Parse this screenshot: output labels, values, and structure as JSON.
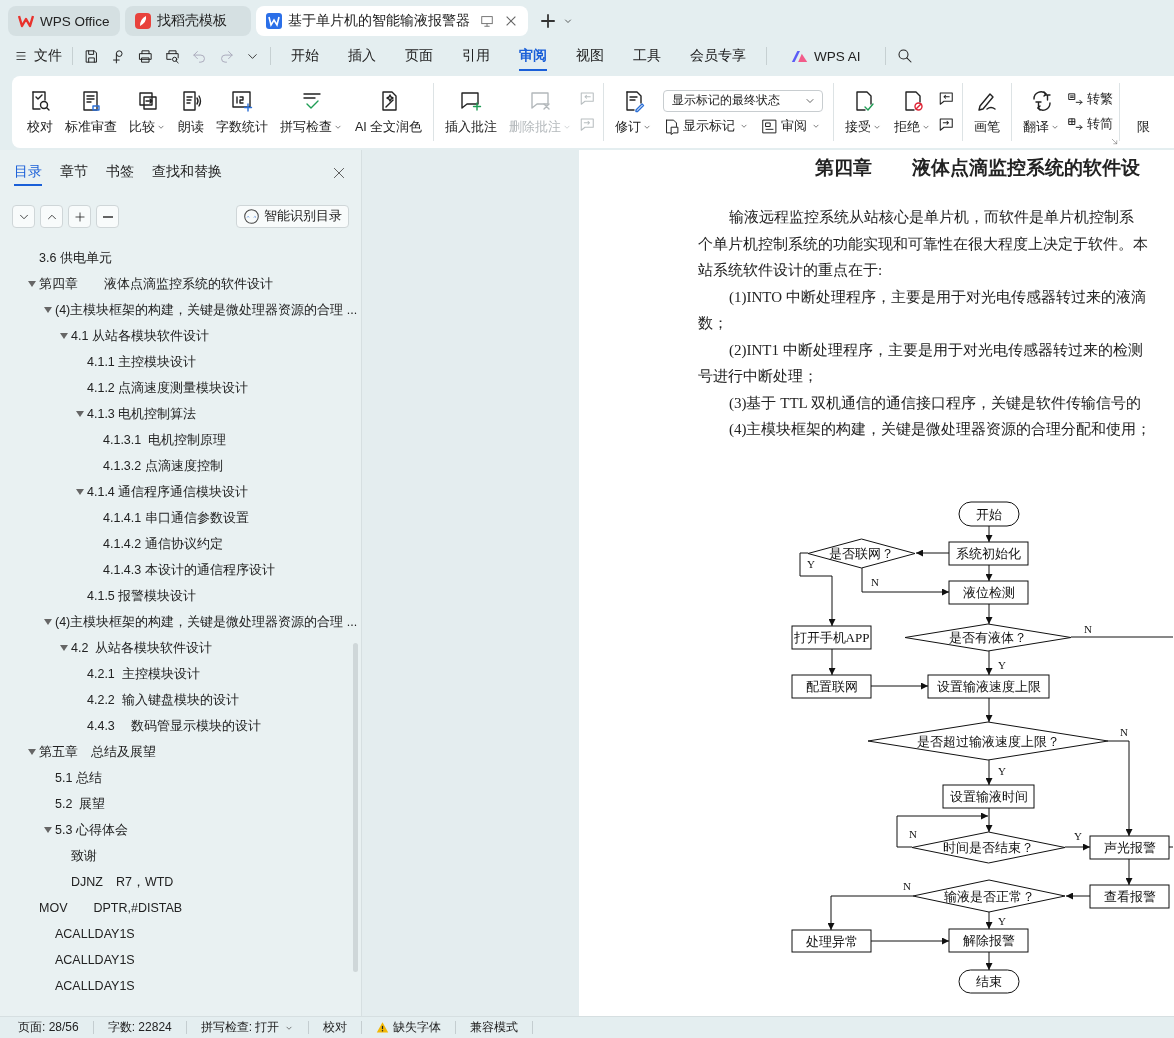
{
  "tabs": [
    {
      "label": "WPS Office",
      "kind": "home",
      "selected": false
    },
    {
      "label": "找稻壳模板",
      "kind": "template",
      "selected": false
    },
    {
      "label": "基于单片机的智能输液报警器",
      "kind": "document",
      "selected": true
    }
  ],
  "menu": {
    "file": "文件",
    "tabs": [
      {
        "label": "开始",
        "selected": false
      },
      {
        "label": "插入",
        "selected": false
      },
      {
        "label": "页面",
        "selected": false
      },
      {
        "label": "引用",
        "selected": false
      },
      {
        "label": "审阅",
        "selected": true
      },
      {
        "label": "视图",
        "selected": false
      },
      {
        "label": "工具",
        "selected": false
      },
      {
        "label": "会员专享",
        "selected": false
      }
    ],
    "ai": "WPS AI"
  },
  "ribbon": [
    {
      "items": [
        {
          "kind": "large",
          "label": "校对",
          "dropdown": false,
          "disabled": false
        },
        {
          "kind": "large",
          "label": "标准审查",
          "dropdown": false,
          "disabled": false
        },
        {
          "kind": "large",
          "label": "比较",
          "dropdown": true,
          "disabled": false
        },
        {
          "kind": "large",
          "label": "朗读",
          "dropdown": false,
          "disabled": false
        },
        {
          "kind": "large",
          "label": "字数统计",
          "dropdown": false,
          "disabled": false
        },
        {
          "kind": "large",
          "label": "拼写检查",
          "dropdown": true,
          "disabled": false
        },
        {
          "kind": "large",
          "label": "AI 全文润色",
          "dropdown": false,
          "disabled": false
        }
      ]
    },
    {
      "items": [
        {
          "kind": "large",
          "label": "插入批注",
          "dropdown": false,
          "disabled": false
        },
        {
          "kind": "large",
          "label": "删除批注",
          "dropdown": true,
          "disabled": true
        },
        {
          "kind": "stack",
          "buttons": [
            {
              "disabled": true
            },
            {
              "disabled": true
            }
          ]
        }
      ]
    },
    {
      "items": [
        {
          "kind": "large",
          "label": "修订",
          "dropdown": true,
          "disabled": false
        },
        {
          "kind": "select_block",
          "value": "显示标记的最终状态",
          "buttons": [
            {
              "label": "显示标记",
              "dropdown": true
            },
            {
              "label": "审阅",
              "dropdown": true
            }
          ]
        }
      ]
    },
    {
      "items": [
        {
          "kind": "large",
          "label": "接受",
          "dropdown": true,
          "disabled": false
        },
        {
          "kind": "large",
          "label": "拒绝",
          "dropdown": true,
          "disabled": false
        },
        {
          "kind": "stack",
          "buttons": [
            {
              "disabled": false
            },
            {
              "disabled": false
            }
          ]
        }
      ]
    },
    {
      "items": [
        {
          "kind": "large",
          "label": "画笔",
          "dropdown": false,
          "disabled": false
        }
      ]
    },
    {
      "launcher": true,
      "items": [
        {
          "kind": "large",
          "label": "翻译",
          "dropdown": true,
          "disabled": false
        },
        {
          "kind": "small_stack",
          "buttons": [
            {
              "label": "转繁"
            },
            {
              "label": "转简"
            }
          ]
        }
      ]
    },
    {
      "items": [
        {
          "kind": "large",
          "label": "限",
          "dropdown": false,
          "disabled": false
        }
      ]
    }
  ],
  "panel": {
    "tabs": [
      {
        "label": "目录",
        "selected": true
      },
      {
        "label": "章节",
        "selected": false
      },
      {
        "label": "书签",
        "selected": false
      },
      {
        "label": "查找和替换",
        "selected": false
      }
    ],
    "smart_button": "智能识别目录",
    "toc": [
      {
        "label": "3.6 供电单元"
      },
      {
        "label": "第四章　　液体点滴监控系统的软件设计",
        "expanded": true,
        "children": [
          {
            "label": "(4)主模块框架的构建，关键是微处理器资源的合理 ...",
            "expanded": true,
            "children": [
              {
                "label": "4.1 从站各模块软件设计",
                "expanded": true,
                "children": [
                  {
                    "label": "4.1.1 主控模块设计"
                  },
                  {
                    "label": "4.1.2 点滴速度测量模块设计"
                  },
                  {
                    "label": "4.1.3 电机控制算法",
                    "expanded": true,
                    "children": [
                      {
                        "label": "4.1.3.1  电机控制原理"
                      },
                      {
                        "label": "4.1.3.2 点滴速度控制"
                      }
                    ]
                  },
                  {
                    "label": "4.1.4 通信程序通信模块设计",
                    "expanded": true,
                    "children": [
                      {
                        "label": "4.1.4.1 串口通信参数设置"
                      },
                      {
                        "label": "4.1.4.2 通信协议约定"
                      },
                      {
                        "label": "4.1.4.3 本设计的通信程序设计"
                      }
                    ]
                  },
                  {
                    "label": "4.1.5 报警模块设计"
                  }
                ]
              }
            ]
          },
          {
            "label": "(4)主模块框架的构建，关键是微处理器资源的合理 ...",
            "expanded": true,
            "children": [
              {
                "label": "4.2  从站各模块软件设计",
                "expanded": true,
                "children": [
                  {
                    "label": "4.2.1  主控模块设计"
                  },
                  {
                    "label": "4.2.2  输入键盘模块的设计"
                  },
                  {
                    "label": "4.4.3　 数码管显示模块的设计"
                  }
                ]
              }
            ]
          }
        ]
      },
      {
        "label": "第五章　总结及展望",
        "expanded": true,
        "children": [
          {
            "label": "5.1 总结"
          },
          {
            "label": "5.2  展望"
          },
          {
            "label": "5.3 心得体会",
            "expanded": true,
            "children": [
              {
                "label": "致谢"
              },
              {
                "label": "DJNZ　R7，WTD"
              }
            ]
          }
        ]
      },
      {
        "label": "MOV　　DPTR,#DISTAB",
        "children": [
          {
            "label": "ACALLDAY1S"
          },
          {
            "label": "ACALLDAY1S"
          },
          {
            "label": "ACALLDAY1S"
          }
        ]
      }
    ]
  },
  "document": {
    "chapter_number": "第四章",
    "chapter_title": "液体点滴监控系统的软件设",
    "lines": [
      {
        "indent": true,
        "text": "输液远程监控系统从站核心是单片机，而软件是单片机控制系"
      },
      {
        "indent": false,
        "text": "个单片机控制系统的功能实现和可靠性在很大程度上决定于软件。本"
      },
      {
        "indent": false,
        "text": "站系统软件设计的重点在于:"
      },
      {
        "indent": true,
        "text": "(1)INTO 中断处理程序，主要是用于对光电传感器转过来的液滴"
      },
      {
        "indent": false,
        "text": "数；"
      },
      {
        "indent": true,
        "text": "(2)INT1 中断处理程序，主要是用于对光电传感器转过来的检测"
      },
      {
        "indent": false,
        "text": "号进行中断处理；"
      },
      {
        "indent": true,
        "text": "(3)基于 TTL 双机通信的通信接口程序，关键是软件传输信号的"
      },
      {
        "indent": true,
        "text": "(4)主模块框架的构建，关键是微处理器资源的合理分配和使用；"
      }
    ],
    "flowchart": {
      "nodes": [
        {
          "kind": "terminal",
          "label": "开始"
        },
        {
          "kind": "process",
          "label": "系统初始化"
        },
        {
          "kind": "decision",
          "label": "是否联网？"
        },
        {
          "kind": "process",
          "label": "液位检测"
        },
        {
          "kind": "process",
          "label": "打开手机APP"
        },
        {
          "kind": "decision",
          "label": "是否有液体？"
        },
        {
          "kind": "process",
          "label": "配置联网"
        },
        {
          "kind": "process",
          "label": "设置输液速度上限"
        },
        {
          "kind": "decision",
          "label": "是否超过输液速度上限？"
        },
        {
          "kind": "process",
          "label": "设置输液时间"
        },
        {
          "kind": "decision",
          "label": "时间是否结束？"
        },
        {
          "kind": "process",
          "label": "声光报警"
        },
        {
          "kind": "process",
          "label": "查看报警"
        },
        {
          "kind": "decision",
          "label": "输液是否正常？"
        },
        {
          "kind": "process",
          "label": "处理异常"
        },
        {
          "kind": "process",
          "label": "解除报警"
        },
        {
          "kind": "terminal",
          "label": "结束"
        }
      ],
      "branch_labels": [
        "Y",
        "N",
        "N",
        "Y",
        "N",
        "Y",
        "N",
        "Y",
        "N",
        "Y"
      ]
    }
  },
  "status_bar": [
    {
      "kind": "text",
      "label": "页面: 28/56"
    },
    {
      "kind": "text",
      "label": "字数: 22824"
    },
    {
      "kind": "dropdown",
      "label": "拼写检查: 打开"
    },
    {
      "kind": "text",
      "label": "校对"
    },
    {
      "kind": "warning",
      "label": "缺失字体"
    },
    {
      "kind": "text",
      "label": "兼容模式"
    }
  ]
}
